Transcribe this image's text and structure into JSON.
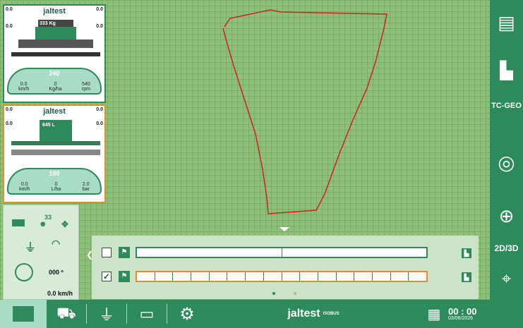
{
  "colors": {
    "brand": "#2d8a5a",
    "map": "#8fc07a",
    "boundary": "#d42020",
    "accent": "#e8892a"
  },
  "panel1": {
    "corner_tl": "0.0",
    "corner_tr": "0.0",
    "corner_ml": "0.0",
    "corner_mr": "0.0",
    "logo": "jaltest",
    "display": "333 Kg",
    "gauge_big": "240",
    "gauge_vals": [
      "0.0",
      "0",
      "540"
    ],
    "gauge_units": [
      "km/h",
      "Kg/ha",
      "rpm"
    ]
  },
  "panel2": {
    "corner_tl": "0.0",
    "corner_tr": "0.0",
    "corner_ml": "0.0",
    "corner_mr": "0.0",
    "logo": "jaltest",
    "display": "645 L",
    "gauge_big": "100",
    "gauge_vals": [
      "0.0",
      "0",
      "2.0"
    ],
    "gauge_units": [
      "km/h",
      "L/ha",
      "bar"
    ]
  },
  "status": {
    "satellites": "33",
    "heading": "000 º",
    "speed": "0.0 km/h"
  },
  "sections": {
    "row1_checked": false,
    "row2_checked": true
  },
  "right": {
    "geo_label": "TC-GEO",
    "view_3d": "3D",
    "view_2d": "2D"
  },
  "toolbar": {
    "brand": "jaltest",
    "brand_sub": "ISOBUS",
    "time": "00 : 00",
    "date": "03/06/2026"
  },
  "icons": [
    "screen-icon",
    "implement-icon",
    "joystick-icon",
    "folder-icon",
    "gear-icon",
    "layout-icon",
    "battery-icon",
    "tasks-icon",
    "steering-wheel-icon",
    "zoom-in-icon",
    "center-icon"
  ]
}
